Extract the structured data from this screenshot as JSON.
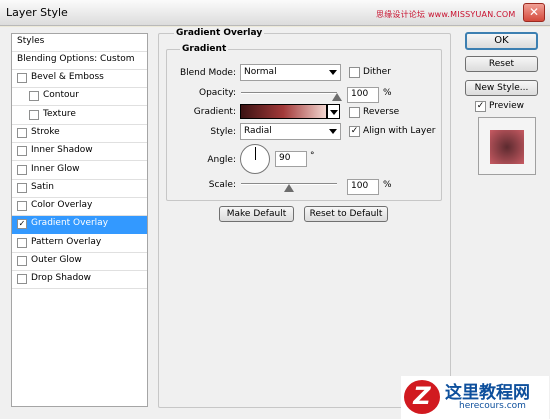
{
  "window": {
    "title": "Layer Style",
    "watermark": "思缘设计论坛 www.MISSYUAN.COM"
  },
  "sidebar": {
    "header": "Styles",
    "blending": "Blending Options: Custom",
    "items": [
      {
        "label": "Bevel & Emboss",
        "checked": false,
        "indent": false,
        "selected": false
      },
      {
        "label": "Contour",
        "checked": false,
        "indent": true,
        "selected": false
      },
      {
        "label": "Texture",
        "checked": false,
        "indent": true,
        "selected": false
      },
      {
        "label": "Stroke",
        "checked": false,
        "indent": false,
        "selected": false
      },
      {
        "label": "Inner Shadow",
        "checked": false,
        "indent": false,
        "selected": false
      },
      {
        "label": "Inner Glow",
        "checked": false,
        "indent": false,
        "selected": false
      },
      {
        "label": "Satin",
        "checked": false,
        "indent": false,
        "selected": false
      },
      {
        "label": "Color Overlay",
        "checked": false,
        "indent": false,
        "selected": false
      },
      {
        "label": "Gradient Overlay",
        "checked": true,
        "indent": false,
        "selected": true
      },
      {
        "label": "Pattern Overlay",
        "checked": false,
        "indent": false,
        "selected": false
      },
      {
        "label": "Outer Glow",
        "checked": false,
        "indent": false,
        "selected": false
      },
      {
        "label": "Drop Shadow",
        "checked": false,
        "indent": false,
        "selected": false
      }
    ]
  },
  "panel": {
    "title": "Gradient Overlay",
    "group_title": "Gradient",
    "blend_mode": {
      "label": "Blend Mode:",
      "value": "Normal"
    },
    "dither": {
      "label": "Dither",
      "checked": false
    },
    "opacity": {
      "label": "Opacity:",
      "value": "100",
      "unit": "%",
      "level": 1.0
    },
    "gradient": {
      "label": "Gradient:",
      "colors": [
        "#3b1212",
        "#a33a3a",
        "#f2d6d0"
      ]
    },
    "reverse": {
      "label": "Reverse",
      "checked": false
    },
    "style": {
      "label": "Style:",
      "value": "Radial"
    },
    "align": {
      "label": "Align with Layer",
      "checked": true
    },
    "angle": {
      "label": "Angle:",
      "value": "90",
      "unit": "°"
    },
    "scale": {
      "label": "Scale:",
      "value": "100",
      "unit": "%",
      "level": 0.5
    },
    "make_default": "Make Default",
    "reset_default": "Reset to Default"
  },
  "buttons": {
    "ok": "OK",
    "cancel": "Reset",
    "new_style": "New Style...",
    "preview_label": "Preview",
    "preview_checked": true
  },
  "logo": {
    "text": "这里教程网",
    "url": "herecours.com"
  },
  "colors": {
    "selection": "#3399ff",
    "logo_red": "#d11a20",
    "preview_dark": "#5c2a2f",
    "preview_light": "#c85b63"
  }
}
